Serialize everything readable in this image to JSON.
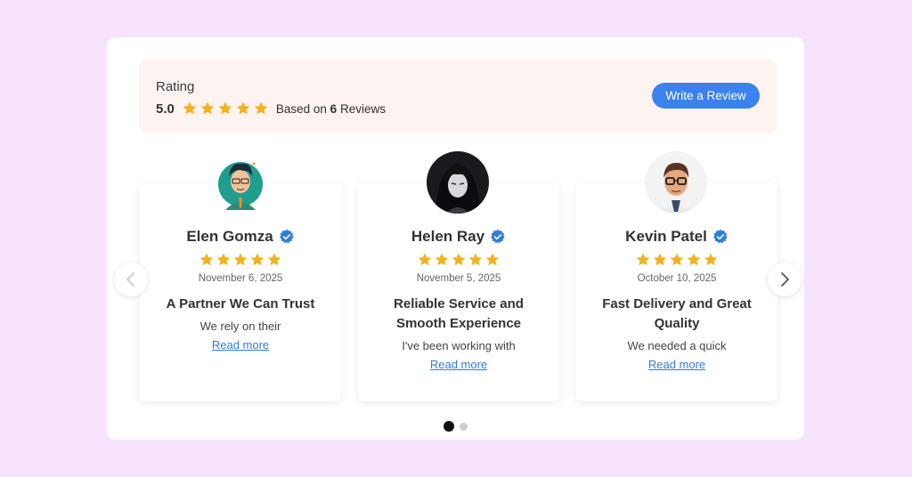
{
  "rating": {
    "label": "Rating",
    "value": "5.0",
    "stars": 5,
    "based_prefix": "Based on",
    "based_count": "6",
    "based_suffix": "Reviews",
    "write_button": "Write a Review"
  },
  "colors": {
    "page_bg": "#f7e3fb",
    "rating_bg": "#fdf3f1",
    "star": "#f5b11a",
    "accent": "#3b82f0",
    "link": "#2f7de1",
    "verified": "#2f7de1"
  },
  "reviews": [
    {
      "name": "Elen Gomza",
      "stars": 5,
      "date": "November 6, 2025",
      "title": "A Partner We Can Trust",
      "excerpt": "We rely on their",
      "read_more": "Read more",
      "avatar_icon": "cartoon-man-avatar"
    },
    {
      "name": "Helen Ray",
      "stars": 5,
      "date": "November 5, 2025",
      "title": "Reliable Service and Smooth Experience",
      "excerpt": "I've been working with",
      "read_more": "Read more",
      "avatar_icon": "anime-girl-avatar"
    },
    {
      "name": "Kevin Patel",
      "stars": 5,
      "date": "October 10, 2025",
      "title": "Fast Delivery and Great Quality",
      "excerpt": "We needed a quick",
      "read_more": "Read more",
      "avatar_icon": "3d-man-with-glasses-avatar"
    }
  ],
  "carousel": {
    "prev_icon": "chevron-left-icon",
    "next_icon": "chevron-right-icon",
    "pages": 2,
    "active_page": 1
  }
}
